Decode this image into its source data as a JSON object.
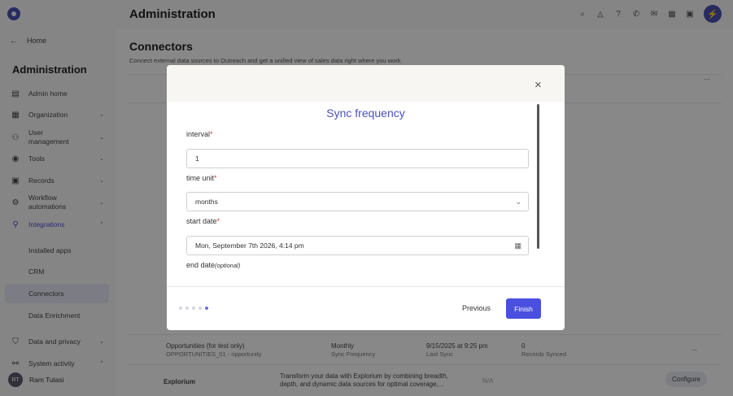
{
  "header": {
    "title": "Administration"
  },
  "sidebar": {
    "home": "Home",
    "title": "Administration",
    "items": [
      {
        "label": "Admin home"
      },
      {
        "label": "Organization"
      },
      {
        "label": "User management"
      },
      {
        "label": "Tools"
      },
      {
        "label": "Records"
      },
      {
        "label": "Workflow automations"
      },
      {
        "label": "Integrations"
      }
    ],
    "subitems": [
      {
        "label": "Installed apps"
      },
      {
        "label": "CRM"
      },
      {
        "label": "Connectors"
      },
      {
        "label": "Data Enrichment"
      }
    ],
    "bottom": [
      {
        "label": "Data and privacy"
      },
      {
        "label": "System activity"
      }
    ],
    "user": {
      "initials": "RT",
      "name": "Ram Tulasi"
    }
  },
  "page": {
    "title": "Connectors",
    "subtitle": "Connect external data sources to Outreach and get a unified view of sales data right where you work"
  },
  "background_rows": {
    "row1": {
      "name": "Opportunities (for test only)",
      "object": "OPPORTUNITIES_01 - opportunity",
      "freq": "Monthly",
      "freq_label": "Sync Frequency",
      "last_sync": "9/15/2025 at 9:25 pm",
      "last_sync_label": "Last Sync",
      "records": "0",
      "records_label": "Records Synced",
      "more": "..."
    },
    "row2": {
      "name": "Explorium",
      "desc1": "Transform your data with Explorium by combining breadth,",
      "desc2": "depth, and dynamic data sources for optimal coverage,...",
      "status": "N/A",
      "action": "Configure"
    },
    "more": "...",
    "d": "d"
  },
  "modal": {
    "close": "×",
    "title": "Sync frequency",
    "interval_label": "interval",
    "interval_value": "1",
    "unit_label": "time unit",
    "unit_value": "months",
    "start_label": "start date",
    "start_value": "Mon, September 7th 2026, 4:14 pm",
    "end_label": "end date",
    "end_optional": "(optional)",
    "required_mark": "*",
    "previous": "Previous",
    "finish": "Finish"
  }
}
